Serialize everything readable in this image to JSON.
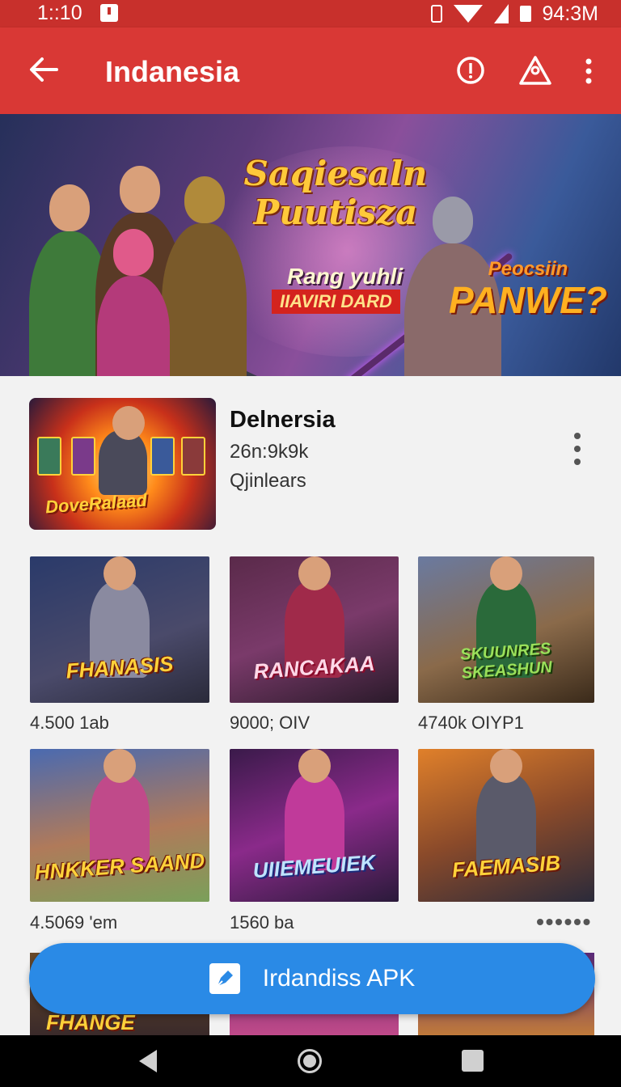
{
  "status_bar": {
    "time": "1::10",
    "battery": "94:3M"
  },
  "app_bar": {
    "title": "Indanesia"
  },
  "banner": {
    "title_line1": "Saqiesaln",
    "title_line2": "Puutisza",
    "subtitle": "Rang yuhli",
    "tag": "IIAVIRI DARD",
    "promo_top": "Peocsiin",
    "promo_main": "PANWE?"
  },
  "featured": {
    "thumb_label": "DoveRalaad",
    "name": "Delnersia",
    "size": "26n:9k9k",
    "status": "Qjinlears"
  },
  "grid": [
    {
      "label": "FHANASIS",
      "caption": "4.500 1ab"
    },
    {
      "label": "RANCAKAA",
      "caption": "9000; OIV"
    },
    {
      "label": "SKUUNRES SKEASHUN",
      "caption": "4740k OIYP1"
    },
    {
      "label": "HNKKER SAAND",
      "caption": "4.5069 'em"
    },
    {
      "label": "UIIEMEUIEK",
      "caption": "1560  ba"
    },
    {
      "label": "FAEMASIB",
      "caption": ""
    }
  ],
  "peek_row": {
    "label": "FHANGE"
  },
  "install_button": {
    "label": "Irdandiss  APK"
  },
  "colors": {
    "app_bar": "#d93835",
    "status_bar": "#c8302c",
    "accent": "#2a8ae6"
  },
  "icons": [
    "back-arrow",
    "info",
    "profile-triangle",
    "more-vertical",
    "install-pen"
  ]
}
